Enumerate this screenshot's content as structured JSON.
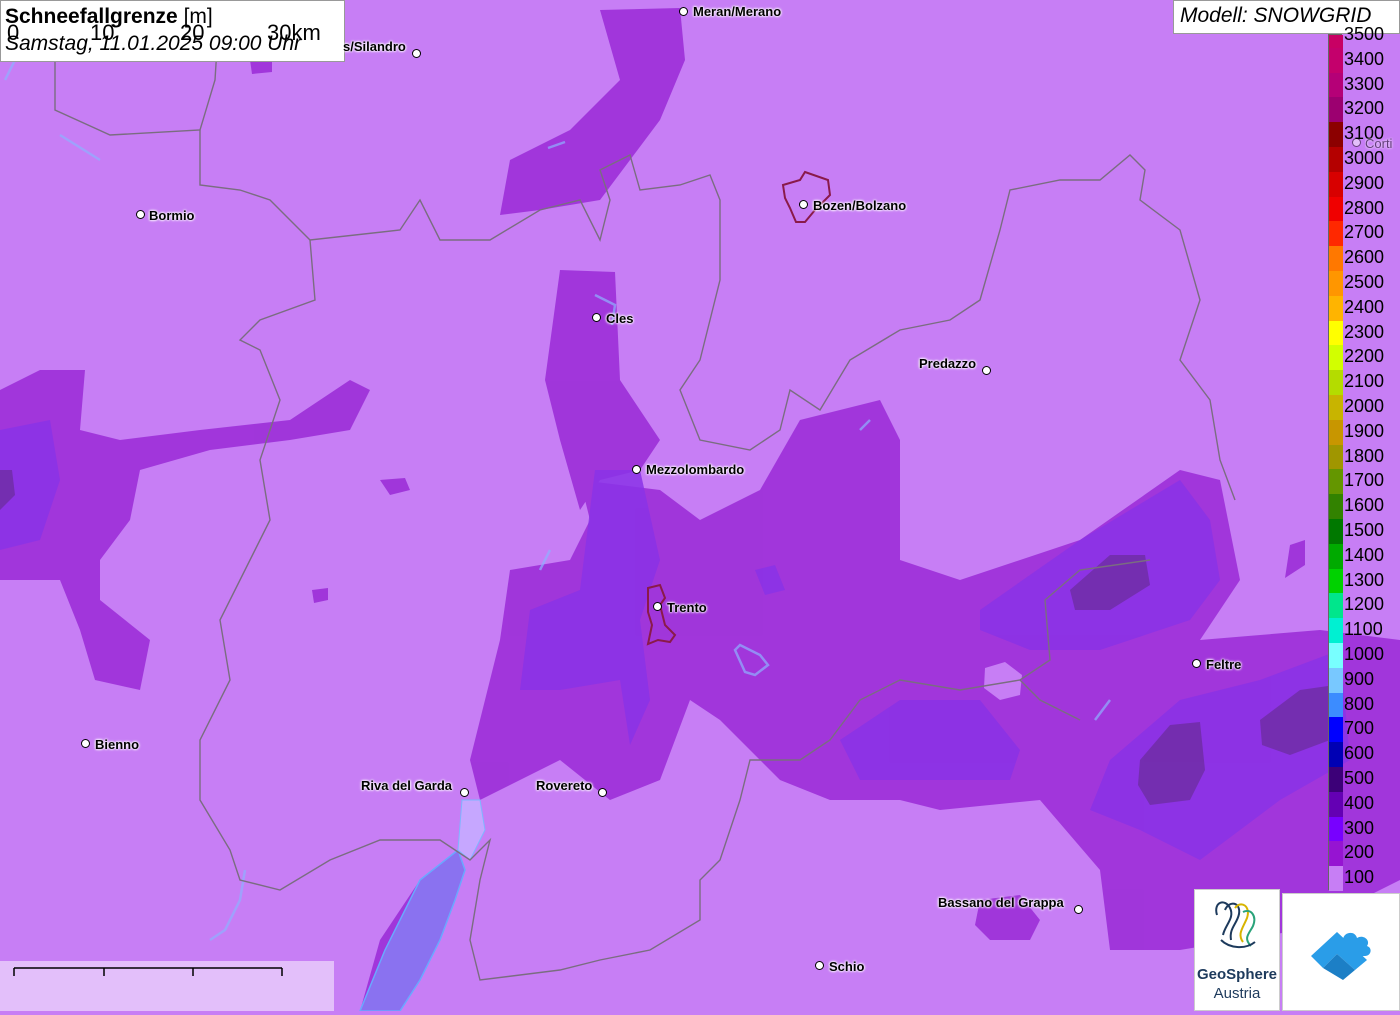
{
  "title": {
    "main": "Schneefallgrenze",
    "unit": "[m]",
    "datetime": "Samstag, 11.01.2025 09:00 Uhr"
  },
  "model": {
    "label": "Modell: SNOWGRID"
  },
  "legend": {
    "entries": [
      {
        "label": "3500",
        "color": "#c80064"
      },
      {
        "label": "3400",
        "color": "#c4006c"
      },
      {
        "label": "3300",
        "color": "#b50077"
      },
      {
        "label": "3200",
        "color": "#9c0070"
      },
      {
        "label": "3100",
        "color": "#8c0000"
      },
      {
        "label": "3000",
        "color": "#b40000"
      },
      {
        "label": "2900",
        "color": "#d80000"
      },
      {
        "label": "2800",
        "color": "#f00000"
      },
      {
        "label": "2700",
        "color": "#ff2800"
      },
      {
        "label": "2600",
        "color": "#ff7800"
      },
      {
        "label": "2500",
        "color": "#ff9600"
      },
      {
        "label": "2400",
        "color": "#ffb400"
      },
      {
        "label": "2300",
        "color": "#ffff00"
      },
      {
        "label": "2200",
        "color": "#d2ff00"
      },
      {
        "label": "2100",
        "color": "#b4dc00"
      },
      {
        "label": "2000",
        "color": "#c8b400"
      },
      {
        "label": "1900",
        "color": "#c89600"
      },
      {
        "label": "1800",
        "color": "#a09600"
      },
      {
        "label": "1700",
        "color": "#649600"
      },
      {
        "label": "1600",
        "color": "#328200"
      },
      {
        "label": "1500",
        "color": "#007800"
      },
      {
        "label": "1400",
        "color": "#00aa00"
      },
      {
        "label": "1300",
        "color": "#00d200"
      },
      {
        "label": "1200",
        "color": "#00e68c"
      },
      {
        "label": "1100",
        "color": "#00f0d2"
      },
      {
        "label": "1000",
        "color": "#78ffff"
      },
      {
        "label": "900",
        "color": "#78c8ff"
      },
      {
        "label": "800",
        "color": "#3c8cff"
      },
      {
        "label": "700",
        "color": "#0000ff"
      },
      {
        "label": "600",
        "color": "#0000b4"
      },
      {
        "label": "500",
        "color": "#3c0078"
      },
      {
        "label": "400",
        "color": "#6400b4"
      },
      {
        "label": "300",
        "color": "#7800ff"
      },
      {
        "label": "200",
        "color": "#9614d2"
      },
      {
        "label": "100",
        "color": "#c77ef5"
      }
    ]
  },
  "cities": [
    {
      "name": "Meran/Merano"
    },
    {
      "name": "s/Silandro"
    },
    {
      "name": "Bormio"
    },
    {
      "name": "Bozen/Bolzano"
    },
    {
      "name": "Cles"
    },
    {
      "name": "Predazzo"
    },
    {
      "name": "Mezzolombardo"
    },
    {
      "name": "Trento"
    },
    {
      "name": "Feltre"
    },
    {
      "name": "Bienno"
    },
    {
      "name": "Riva del Garda"
    },
    {
      "name": "Rovereto"
    },
    {
      "name": "Bassano del Grappa"
    },
    {
      "name": "Schio"
    },
    {
      "name": "Corti"
    }
  ],
  "scale": {
    "labels": [
      "0",
      "10",
      "20",
      "30km"
    ]
  },
  "logo": {
    "name_line1": "GeoSphere",
    "name_line2": "Austria"
  }
}
